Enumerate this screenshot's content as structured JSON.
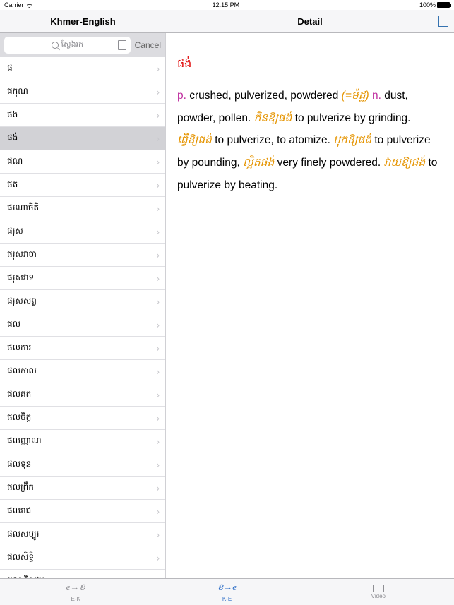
{
  "status": {
    "carrier": "Carrier",
    "wifi": "ᯤ",
    "time": "12:15 PM",
    "battery": "100%"
  },
  "nav": {
    "left_title": "Khmer-English",
    "right_title": "Detail"
  },
  "search": {
    "placeholder": "ស្វែងរក",
    "cancel": "Cancel"
  },
  "selected_index": 3,
  "list": [
    "ផ",
    "ផកុណ",
    "ផង",
    "ផង់",
    "ផណ",
    "ផត",
    "ផរណាចិតិ",
    "ផរុស",
    "ផរុសវាចា",
    "ផរុសវាទ",
    "ផរុសសព្វ",
    "ផល",
    "ផលការ",
    "ផលកាល",
    "ផលគត",
    "ផលចិត្ត",
    "ផលញ្ញាណ",
    "ផលទុន",
    "ផលព្រឹក",
    "ផលរាជ",
    "ផលសម្បូរ",
    "ផលសិទ្ធិ",
    "ផលានិសង្ស"
  ],
  "entry": {
    "headword": "ផង់",
    "pos1": "p.",
    "def1": " crushed, pulverized, powdered ",
    "equiv": "(=ម៉ដ្ឋ)",
    "pos2": " n.",
    "def2": " dust, powder, pollen. ",
    "kh1": "កិនឱ្យផង់",
    "en1": " to pulverize by grinding. ",
    "kh2": "ធ្វើឱ្យផង់",
    "en2": " to pulverize, to atomize. ",
    "kh3": "បុក​ឱ្យផង់",
    "en3": " to pulverize by pounding, ",
    "kh4": "ល្អិតផង់",
    "en4": " very finely powdered. ",
    "kh5": "វាយឱ្យផង់",
    "en5": " to pulverize by beating."
  },
  "tabs": [
    {
      "icon": "e→ខ",
      "label": "E-K"
    },
    {
      "icon": "ខ→e",
      "label": "K-E"
    },
    {
      "icon": "",
      "label": "Video"
    }
  ],
  "active_tab": 1
}
